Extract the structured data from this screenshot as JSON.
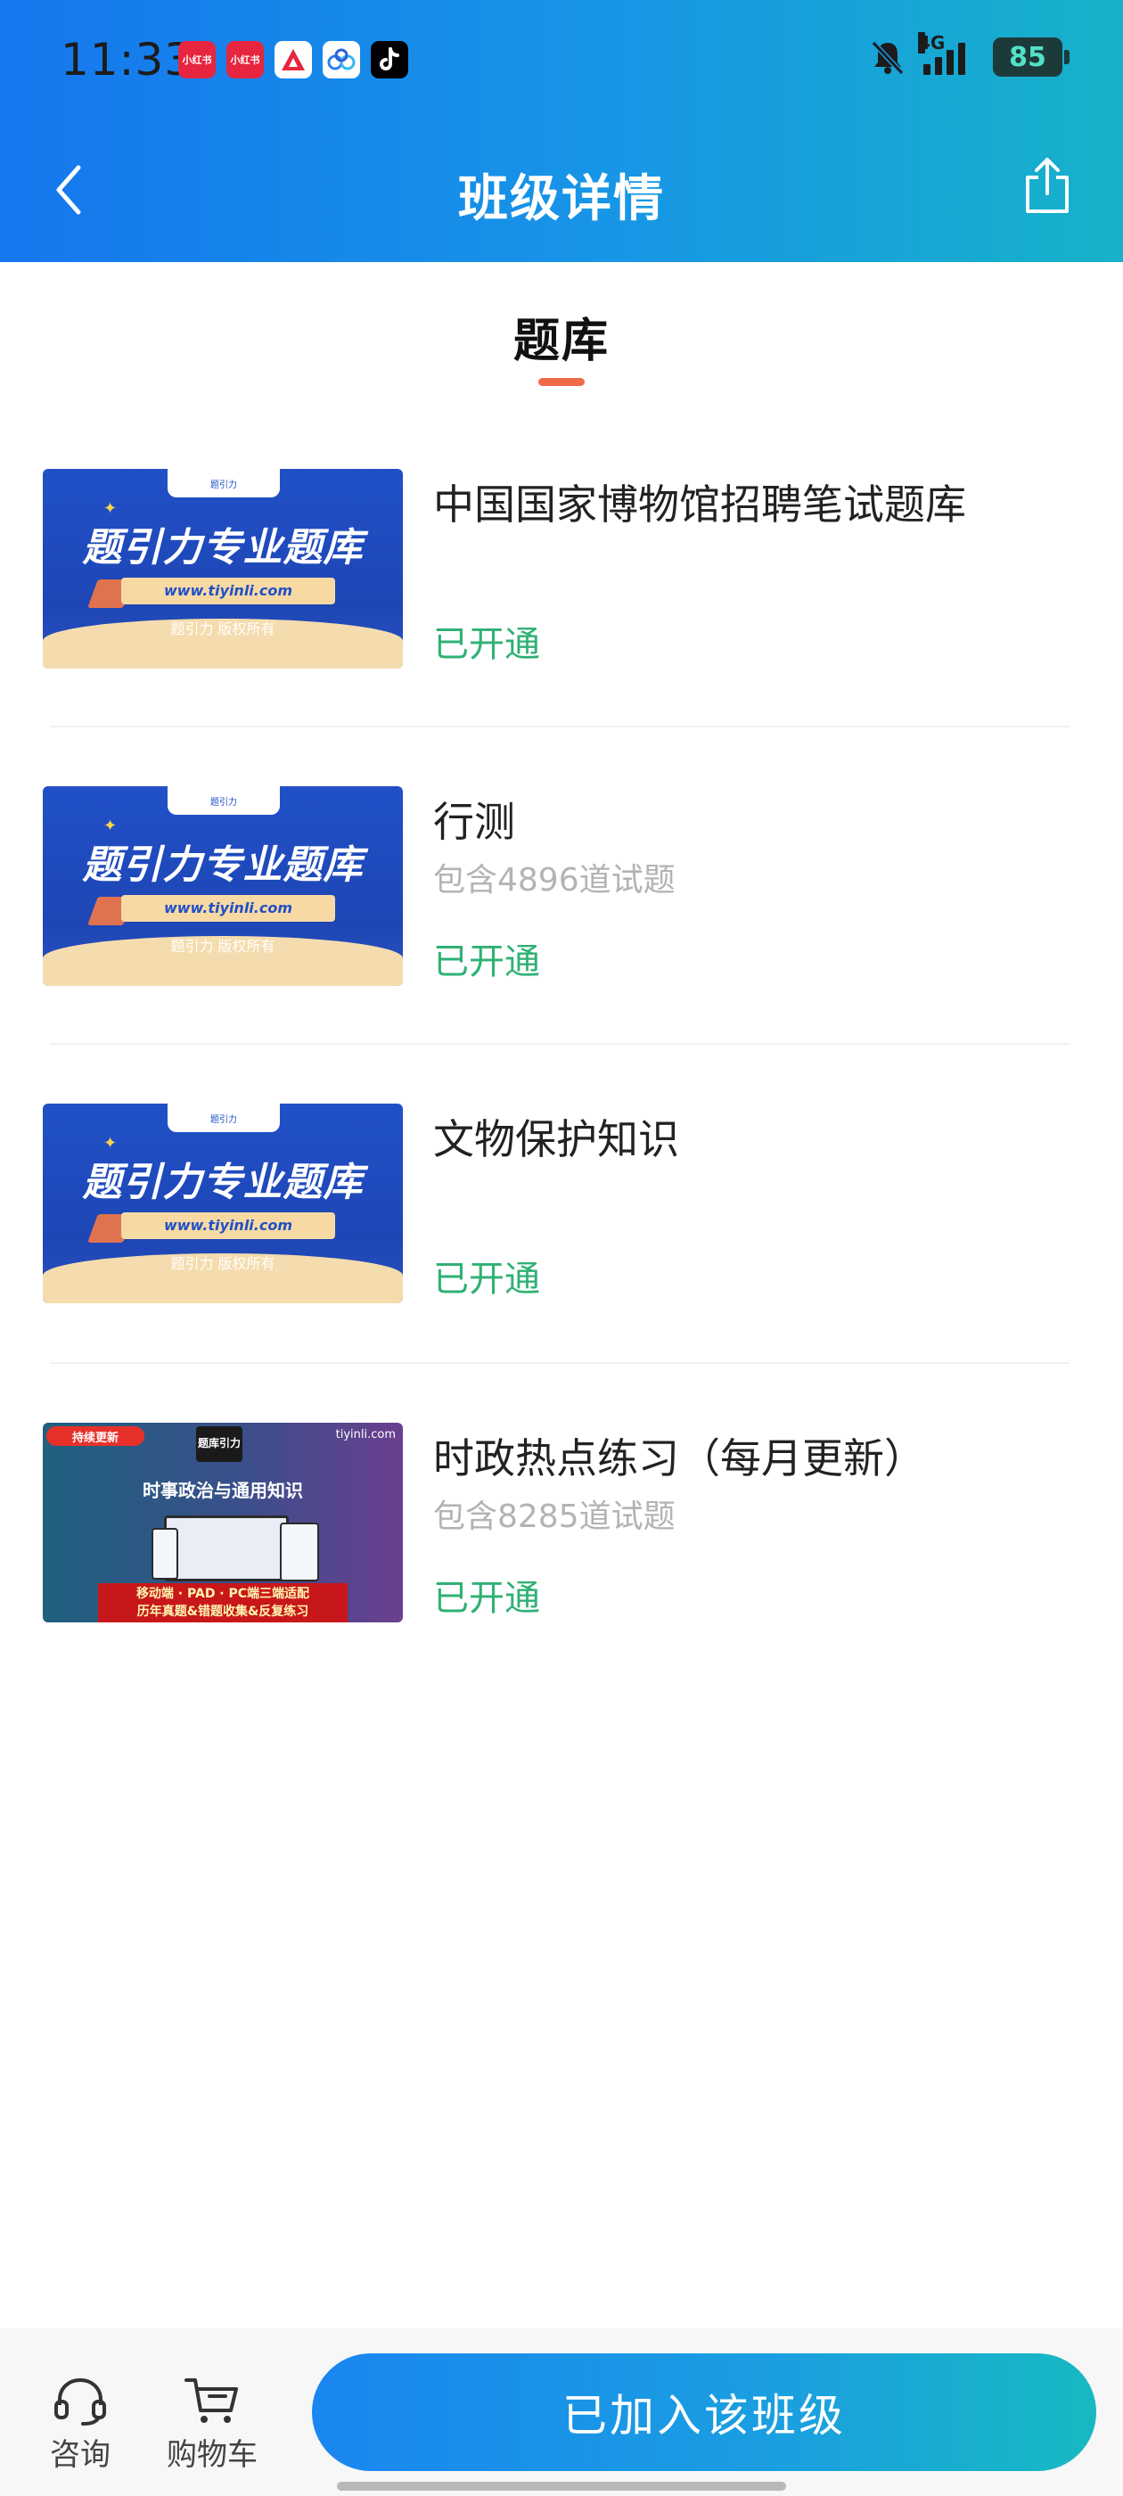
{
  "status_bar": {
    "time": "11:33",
    "network": "4G",
    "battery": "85",
    "apps": [
      {
        "name": "xiaohongshu-icon",
        "label": "小红书"
      },
      {
        "name": "xiaohongshu-icon",
        "label": "小红书"
      },
      {
        "name": "red-app-icon",
        "label": ""
      },
      {
        "name": "baidu-netdisk-icon",
        "label": ""
      },
      {
        "name": "tiktok-icon",
        "label": ""
      }
    ]
  },
  "nav": {
    "title": "班级详情"
  },
  "tab": {
    "label": "题库"
  },
  "thumb_blue": {
    "top_label": "题引力",
    "headline": "题引力专业题库",
    "url": "www.tiyinli.com",
    "copyright": "题引力 版权所有"
  },
  "thumb_grad": {
    "badge": "持续更新",
    "logo": "题库引力",
    "site": "tiyinli.com",
    "subtitle": "时事政治与通用知识",
    "bar_line1": "移动端 · PAD · PC端三端适配",
    "bar_line2": "历年真题&错题收集&反复练习"
  },
  "items": [
    {
      "title": "中国国家博物馆招聘笔试题库",
      "subtitle": "",
      "status": "已开通"
    },
    {
      "title": "行测",
      "subtitle": "包含4896道试题",
      "status": "已开通"
    },
    {
      "title": "文物保护知识",
      "subtitle": "",
      "status": "已开通"
    },
    {
      "title": "时政热点练习（每月更新）",
      "subtitle": "包含8285道试题",
      "status": "已开通"
    }
  ],
  "bottom": {
    "consult_label": "咨询",
    "cart_label": "购物车",
    "join_label": "已加入该班级"
  },
  "colors": {
    "header_start": "#1677ee",
    "header_end": "#17b2c9",
    "status_green": "#2fb174",
    "tab_underline": "#f06a4a"
  }
}
